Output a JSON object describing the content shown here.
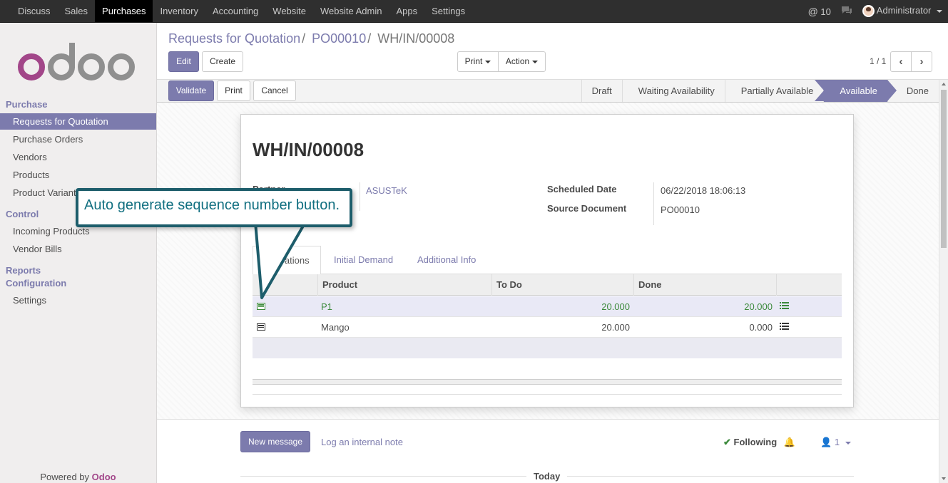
{
  "topbar": {
    "menu": [
      "Discuss",
      "Sales",
      "Purchases",
      "Inventory",
      "Accounting",
      "Website",
      "Website Admin",
      "Apps",
      "Settings"
    ],
    "active_menu": "Purchases",
    "notifications": "10",
    "user": "Administrator"
  },
  "sidebar": {
    "powered_by": "Powered by",
    "brand": "Odoo",
    "sections": [
      {
        "title": "Purchase"
      },
      {
        "title": "Control"
      },
      {
        "title": "Reports"
      },
      {
        "title": "Configuration"
      }
    ],
    "items": {
      "rfq": "Requests for Quotation",
      "purchase_orders": "Purchase Orders",
      "vendors": "Vendors",
      "products": "Products",
      "product_variants": "Product Variants",
      "incoming_products": "Incoming Products",
      "vendor_bills": "Vendor Bills",
      "settings": "Settings"
    }
  },
  "breadcrumb": {
    "level1": "Requests for Quotation",
    "level2": "PO00010",
    "current": "WH/IN/00008"
  },
  "buttons": {
    "edit": "Edit",
    "create": "Create",
    "print_menu": "Print",
    "action_menu": "Action",
    "validate": "Validate",
    "print": "Print",
    "cancel": "Cancel"
  },
  "pager": "1 / 1",
  "statusbar": [
    "Draft",
    "Waiting Availability",
    "Partially Available",
    "Available",
    "Done"
  ],
  "status_current": "Available",
  "form": {
    "reference": "WH/IN/00008",
    "partner_label": "Partner",
    "partner_value": "ASUSTeK",
    "scheduled_date_label": "Scheduled Date",
    "scheduled_date_value": "06/22/2018 18:06:13",
    "source_document_label": "Source Document",
    "source_document_value": "PO00010"
  },
  "tabs": [
    "Operations",
    "Initial Demand",
    "Additional Info"
  ],
  "table": {
    "headers": [
      "Product",
      "To Do",
      "Done"
    ],
    "rows": [
      {
        "product": "P1",
        "todo": "20.000",
        "done": "20.000"
      },
      {
        "product": "Mango",
        "todo": "20.000",
        "done": "0.000"
      }
    ]
  },
  "chatter": {
    "new_message": "New message",
    "log_note": "Log an internal note",
    "following": "Following",
    "followers_count": "1",
    "today": "Today"
  },
  "callout": "Auto generate sequence number button.",
  "colors": {
    "brand": "#7c7bad",
    "topbar": "#2f2f2f",
    "callout_border": "#1d5d6b",
    "callout_text": "#116f80",
    "done_green": "#3c8a3c"
  }
}
